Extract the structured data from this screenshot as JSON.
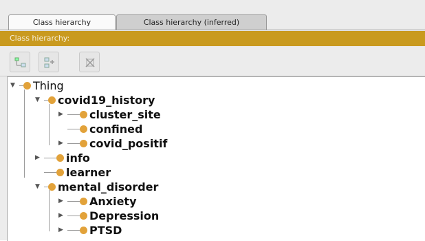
{
  "tabs": [
    {
      "label": "Class hierarchy",
      "active": true
    },
    {
      "label": "Class hierarchy (inferred)",
      "active": false
    }
  ],
  "panel": {
    "title": "Class hierarchy:"
  },
  "toolbar": {
    "buttons": [
      {
        "icon": "add-subclass-icon"
      },
      {
        "icon": "add-sibling-class-icon"
      },
      {
        "icon": "delete-class-icon"
      }
    ]
  },
  "colors": {
    "accent": "#c99a1f",
    "class_dot": "#e2a23a"
  },
  "tree": {
    "root": "Thing",
    "items": [
      {
        "label": "covid19_history"
      },
      {
        "label": "cluster_site"
      },
      {
        "label": "confined"
      },
      {
        "label": "covid_positif"
      },
      {
        "label": "info"
      },
      {
        "label": "learner"
      },
      {
        "label": "mental_disorder"
      },
      {
        "label": "Anxiety"
      },
      {
        "label": "Depression"
      },
      {
        "label": "PTSD"
      }
    ]
  }
}
